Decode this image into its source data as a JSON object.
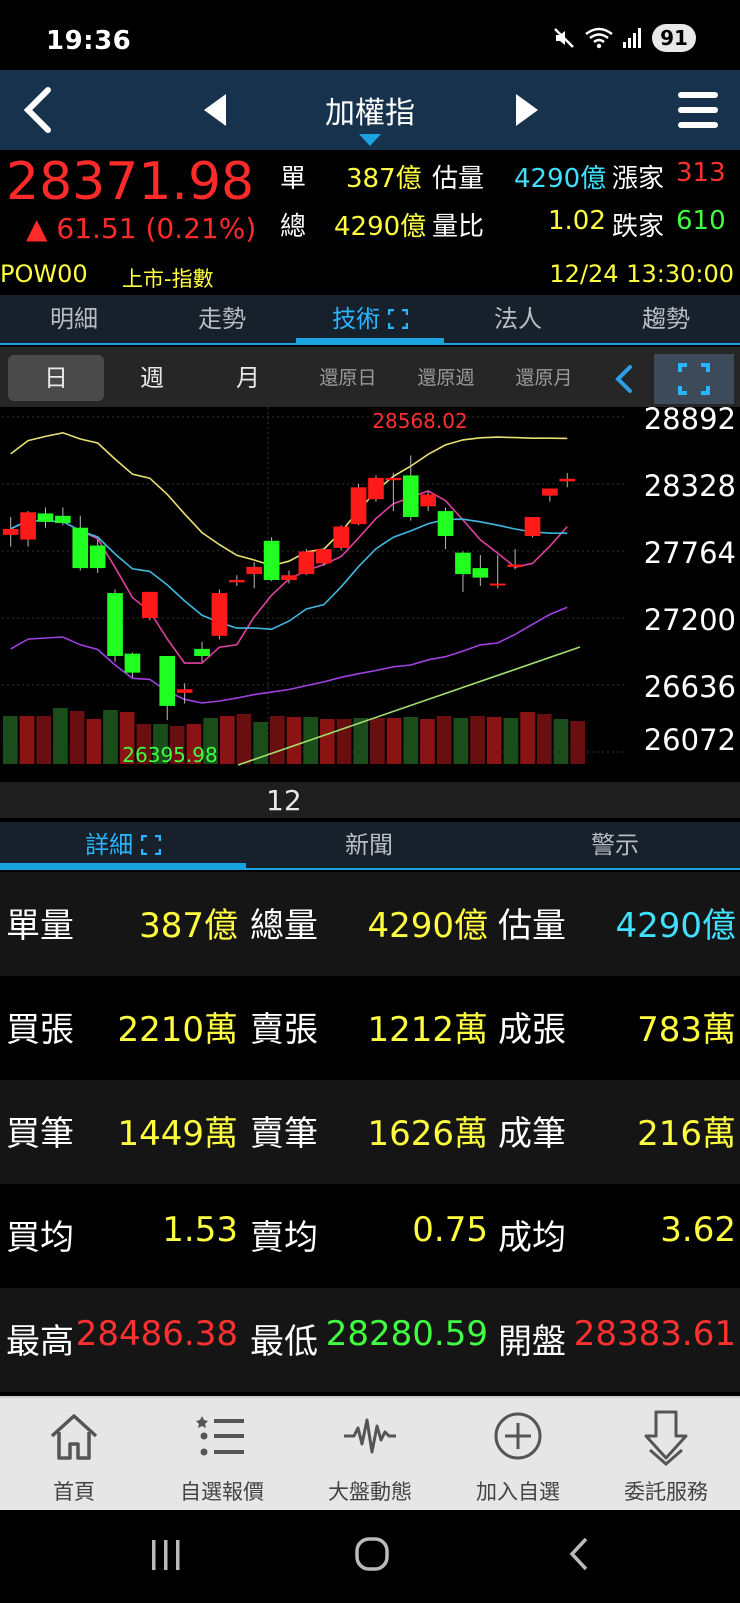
{
  "status_bar": {
    "time": "19:36",
    "battery": "91"
  },
  "header": {
    "title": "加權指"
  },
  "quote": {
    "price": "28371.98",
    "change": "▲ 61.51 (0.21%)",
    "row1": {
      "label1": "單",
      "value1": "387億",
      "label2": "估量",
      "value2": "4290億",
      "label3": "漲家",
      "value3": "313"
    },
    "row2": {
      "label1": "總",
      "value1": "4290億",
      "label2": "量比",
      "value2": "1.02",
      "label3": "跌家",
      "value3": "610"
    },
    "code": "POW00",
    "market": "上市-指數",
    "datetime": "12/24 13:30:00"
  },
  "main_tabs": [
    "明細",
    "走勢",
    "技術",
    "法人",
    "趨勢"
  ],
  "period_tabs": [
    "日",
    "週",
    "月",
    "還原日",
    "還原週",
    "還原月"
  ],
  "chart_data": {
    "type": "candlestick",
    "y_ticks": [
      "28892",
      "28328",
      "27764",
      "27200",
      "26636",
      "26072"
    ],
    "ylim": [
      26072,
      28892
    ],
    "high_label": "28568.02",
    "low_label": "26395.98",
    "x_label": "12",
    "candles": [
      {
        "o": 27900,
        "h": 28050,
        "l": 27800,
        "c": 27950
      },
      {
        "o": 27860,
        "h": 28100,
        "l": 27800,
        "c": 28090
      },
      {
        "o": 28080,
        "h": 28130,
        "l": 27960,
        "c": 28010
      },
      {
        "o": 28060,
        "h": 28130,
        "l": 27980,
        "c": 28000
      },
      {
        "o": 27960,
        "h": 28060,
        "l": 27600,
        "c": 27620
      },
      {
        "o": 27810,
        "h": 27860,
        "l": 27580,
        "c": 27620
      },
      {
        "o": 27410,
        "h": 27440,
        "l": 26830,
        "c": 26880
      },
      {
        "o": 26900,
        "h": 26910,
        "l": 26700,
        "c": 26740
      },
      {
        "o": 27200,
        "h": 27420,
        "l": 27180,
        "c": 27420
      },
      {
        "o": 26880,
        "h": 26880,
        "l": 26340,
        "c": 26460
      },
      {
        "o": 26570,
        "h": 26650,
        "l": 26480,
        "c": 26600
      },
      {
        "o": 26940,
        "h": 27000,
        "l": 26830,
        "c": 26880
      },
      {
        "o": 27050,
        "h": 27440,
        "l": 27020,
        "c": 27410
      },
      {
        "o": 27500,
        "h": 27560,
        "l": 27470,
        "c": 27520
      },
      {
        "o": 27570,
        "h": 27670,
        "l": 27450,
        "c": 27630
      },
      {
        "o": 27850,
        "h": 27880,
        "l": 27510,
        "c": 27520
      },
      {
        "o": 27520,
        "h": 27600,
        "l": 27490,
        "c": 27560
      },
      {
        "o": 27570,
        "h": 27780,
        "l": 27560,
        "c": 27760
      },
      {
        "o": 27660,
        "h": 27790,
        "l": 27640,
        "c": 27780
      },
      {
        "o": 27790,
        "h": 27980,
        "l": 27770,
        "c": 27970
      },
      {
        "o": 27990,
        "h": 28330,
        "l": 27980,
        "c": 28300
      },
      {
        "o": 28200,
        "h": 28400,
        "l": 28180,
        "c": 28380
      },
      {
        "o": 28360,
        "h": 28420,
        "l": 28100,
        "c": 28380
      },
      {
        "o": 28400,
        "h": 28568,
        "l": 28020,
        "c": 28050
      },
      {
        "o": 28140,
        "h": 28260,
        "l": 28100,
        "c": 28240
      },
      {
        "o": 28100,
        "h": 28130,
        "l": 27780,
        "c": 27890
      },
      {
        "o": 27750,
        "h": 27760,
        "l": 27420,
        "c": 27570
      },
      {
        "o": 27620,
        "h": 27730,
        "l": 27470,
        "c": 27540
      },
      {
        "o": 27480,
        "h": 27730,
        "l": 27450,
        "c": 27490
      },
      {
        "o": 27630,
        "h": 27780,
        "l": 27610,
        "c": 27650
      },
      {
        "o": 27890,
        "h": 28040,
        "l": 27880,
        "c": 28050
      },
      {
        "o": 28230,
        "h": 28280,
        "l": 28180,
        "c": 28290
      },
      {
        "o": 28350,
        "h": 28420,
        "l": 28300,
        "c": 28372
      }
    ],
    "volumes": [
      48,
      48,
      48,
      56,
      53,
      45,
      54,
      52,
      40,
      40,
      38,
      40,
      46,
      48,
      50,
      42,
      48,
      47,
      47,
      45,
      45,
      46,
      46,
      46,
      47,
      45,
      48,
      46,
      48,
      47,
      46,
      52,
      50,
      45,
      43
    ]
  },
  "detail_tabs": [
    "詳細",
    "新聞",
    "警示"
  ],
  "details": [
    {
      "l1": "單量",
      "v1": "387億",
      "l2": "總量",
      "v2": "4290億",
      "l3": "估量",
      "v3": "4290億",
      "c1": "#ffff40",
      "c2": "#ffff40",
      "c3": "#40e0ff"
    },
    {
      "l1": "買張",
      "v1": "2210萬",
      "l2": "賣張",
      "v2": "1212萬",
      "l3": "成張",
      "v3": "783萬",
      "c1": "#ffff40",
      "c2": "#ffff40",
      "c3": "#ffff40"
    },
    {
      "l1": "買筆",
      "v1": "1449萬",
      "l2": "賣筆",
      "v2": "1626萬",
      "l3": "成筆",
      "v3": "216萬",
      "c1": "#ffff40",
      "c2": "#ffff40",
      "c3": "#ffff40"
    },
    {
      "l1": "買均",
      "v1": "1.53",
      "l2": "賣均",
      "v2": "0.75",
      "l3": "成均",
      "v3": "3.62",
      "c1": "#ffff40",
      "c2": "#ffff40",
      "c3": "#ffff40"
    },
    {
      "l1": "最高",
      "v1": "28486.38",
      "l2": "最低",
      "v2": "28280.59",
      "l3": "開盤",
      "v3": "28383.61",
      "c1": "#ff3030",
      "c2": "#40ff40",
      "c3": "#ff3030"
    }
  ],
  "bottom_nav": [
    {
      "label": "首頁",
      "icon": "home-icon"
    },
    {
      "label": "自選報價",
      "icon": "list-icon"
    },
    {
      "label": "大盤動態",
      "icon": "pulse-icon"
    },
    {
      "label": "加入自選",
      "icon": "add-circle-icon"
    },
    {
      "label": "委託服務",
      "icon": "order-down-icon"
    }
  ]
}
